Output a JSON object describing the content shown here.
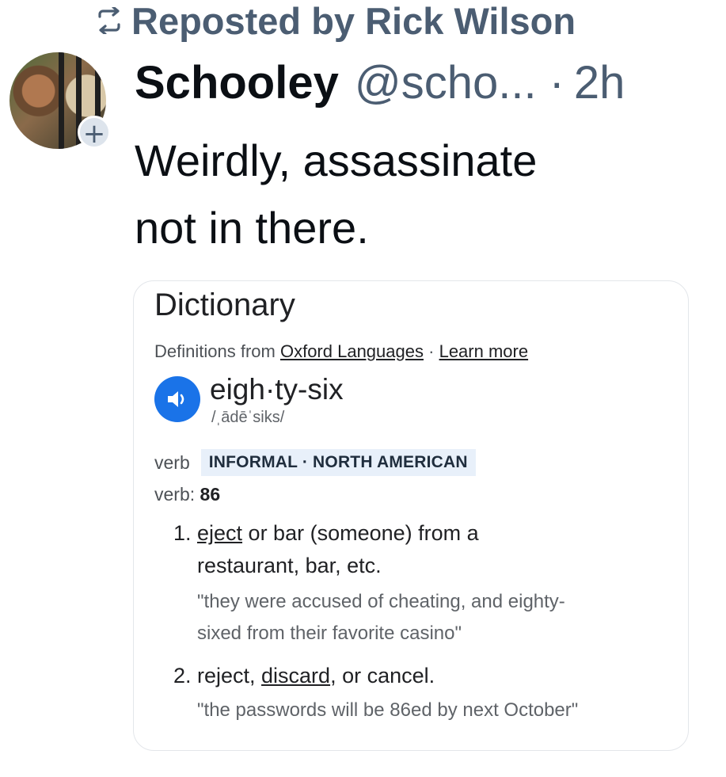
{
  "repost": {
    "icon": "repost-icon",
    "label": "Reposted by Rick Wilson"
  },
  "post": {
    "author_name": "Schooley",
    "handle": "@scho...",
    "separator": "·",
    "time": "2h",
    "text_line1": "Weirdly, assassinate",
    "text_line2": "not in there.",
    "avatar_add": "+"
  },
  "dictionary_card": {
    "title": "Dictionary",
    "source_prefix": "Definitions from",
    "source_link": "Oxford Languages",
    "source_separator": "·",
    "learn_more": "Learn more",
    "headword": "eigh·ty-six",
    "pronunciation": "/ˌādēˈsiks/",
    "part_of_speech": "verb",
    "register": "INFORMAL · NORTH AMERICAN",
    "variant_label": "verb:",
    "variant_value": "86",
    "senses": [
      {
        "number": "1.",
        "link_word": "eject",
        "rest_line1": " or bar (someone) from a",
        "rest_line2": "restaurant, bar, etc.",
        "example_line1": "\"they were accused of cheating, and eighty-",
        "example_line2": "sixed from their favorite casino\""
      },
      {
        "number": "2.",
        "prefix": "reject, ",
        "link_word": "discard",
        "suffix": ", or cancel.",
        "example_line1": "\"the passwords will be 86ed by next October\""
      }
    ]
  },
  "colors": {
    "muted_blue_gray": "#4b5d72",
    "text_primary": "#0b0f14",
    "speaker_blue": "#1a73e8",
    "register_bg": "#e8f0fa"
  }
}
